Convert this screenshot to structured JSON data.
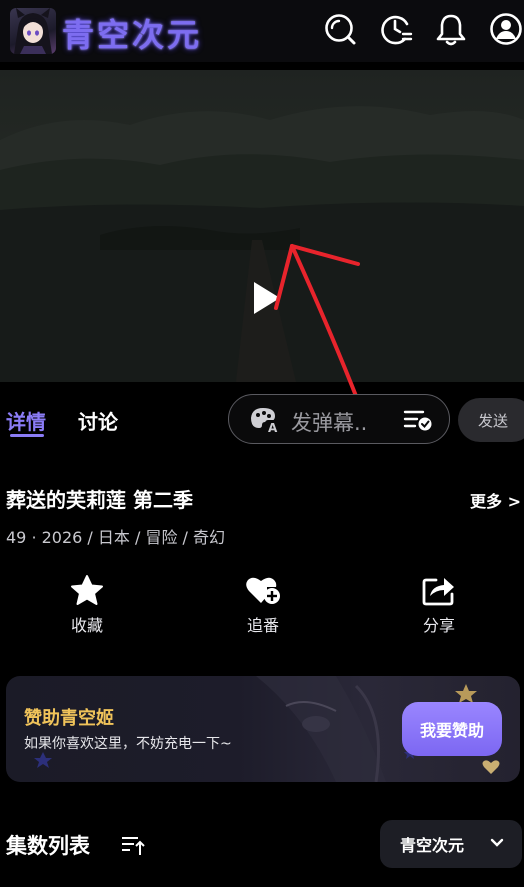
{
  "header": {
    "brand_title": "青空次元",
    "icons": [
      "search-icon",
      "history-icon",
      "notification-bell-icon",
      "user-profile-icon"
    ]
  },
  "player": {
    "play_icon": "play-icon",
    "annotation": "red hand-drawn arrow pointing at play button"
  },
  "tabs": [
    {
      "label": "详情",
      "active": true
    },
    {
      "label": "讨论",
      "active": false
    }
  ],
  "danmaku": {
    "placeholder": "发弹幕..",
    "send_label": "发送"
  },
  "anime": {
    "title": "葬送的芙莉莲 第二季",
    "more_label": "更多 >",
    "meta": "49 · 2026 / 日本 / 冒险 / 奇幻"
  },
  "actions": [
    {
      "label": "收藏",
      "icon": "star-icon"
    },
    {
      "label": "追番",
      "icon": "heart-plus-icon"
    },
    {
      "label": "分享",
      "icon": "share-icon"
    }
  ],
  "sponsor": {
    "title": "赞助青空姬",
    "subtitle": "如果你喜欢这里，不妨充电一下~",
    "button_label": "我要赞助"
  },
  "episodes": {
    "title": "集数列表",
    "source_label": "青空次元"
  },
  "colors": {
    "accent": "#8b7cf6",
    "sponsor_title": "#f0c35a",
    "annotation_red": "#e8242c"
  }
}
